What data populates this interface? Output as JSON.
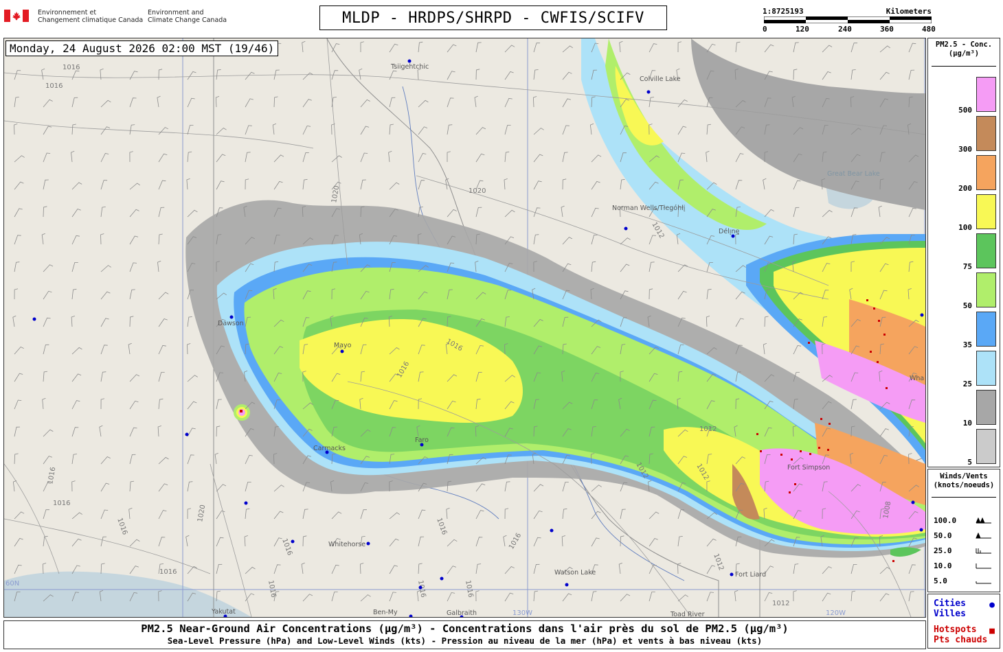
{
  "header": {
    "dept_fr_line1": "Environnement et",
    "dept_fr_line2": "Changement climatique Canada",
    "dept_en_line1": "Environment and",
    "dept_en_line2": "Climate Change Canada",
    "title": "MLDP - HRDPS/SHRPD - CWFIS/SCIFV"
  },
  "scale": {
    "ratio": "1:8725193",
    "units": "Kilometers",
    "ticks": [
      "0",
      "120",
      "240",
      "360",
      "480"
    ]
  },
  "timestamp": "Monday, 24 August 2026 02:00 MST (19/46)",
  "map": {
    "isobar_labels": [
      "1016",
      "1016",
      "1020",
      "1020",
      "1012",
      "1016",
      "1016",
      "1012",
      "1012",
      "1012",
      "1008",
      "1016",
      "1020",
      "1016",
      "1016",
      "1016",
      "1016",
      "1016",
      "1016",
      "1016",
      "1016",
      "1012",
      "1012",
      "1016"
    ],
    "places": [
      "Tsiigehtchic",
      "Colville Lake",
      "Norman Wells/Tłegóhłį",
      "Délı̨nę",
      "Great Bear Lake",
      "Dawson",
      "Mayo",
      "Carmacks",
      "Faro",
      "Whitehorse",
      "Watson Lake",
      "Fort Liard",
      "Yakutat",
      "Toad River",
      "Ben-My",
      "Galbraith",
      "Fort Simpson",
      "Wha"
    ],
    "grid_labels": [
      "60N",
      "130W",
      "120W"
    ],
    "colors": {
      "background": "#ece9e1",
      "water": "#c5d6de",
      "pink": "#f59cf5",
      "brown": "#c48a5a",
      "orange": "#f5a45e",
      "yellow": "#f8f855",
      "dark_green": "#5cc55c",
      "light_green": "#b0ee6b",
      "blue": "#5aa8f6",
      "light_blue": "#ade2f8",
      "dark_grey": "#a7a7a7",
      "light_grey": "#cbcbcb",
      "city": "#0000cc",
      "hotspot": "#cc0000"
    }
  },
  "legend_conc": {
    "title_line1": "PM2.5 - Conc.",
    "title_line2": "(µg/m³)",
    "items": [
      {
        "label": "500",
        "color": "#f59cf5"
      },
      {
        "label": "300",
        "color": "#c48a5a"
      },
      {
        "label": "200",
        "color": "#f5a45e"
      },
      {
        "label": "100",
        "color": "#f8f855"
      },
      {
        "label": "75",
        "color": "#5cc55c"
      },
      {
        "label": "50",
        "color": "#b0ee6b"
      },
      {
        "label": "35",
        "color": "#5aa8f6"
      },
      {
        "label": "25",
        "color": "#ade2f8"
      },
      {
        "label": "10",
        "color": "#a7a7a7"
      },
      {
        "label": "5",
        "color": "#cbcbcb"
      }
    ]
  },
  "legend_wind": {
    "title_line1": "Winds/Vents",
    "title_line2": "(knots/noeuds)",
    "items": [
      "100.0",
      "50.0",
      "25.0",
      "10.0",
      "5.0"
    ]
  },
  "legend_markers": {
    "cities_en": "Cities",
    "cities_fr": "Villes",
    "hotspots_en": "Hotspots",
    "hotspots_fr": "Pts chauds",
    "city_color": "#0000cc",
    "hotspot_color": "#cc0000"
  },
  "caption": {
    "line1": "PM2.5 Near-Ground Air Concentrations (µg/m³) - Concentrations dans l'air près du sol de PM2.5 (µg/m³)",
    "line2": "Sea-Level Pressure (hPa) and Low-Level Winds (kts) - Pression au niveau de la mer (hPa) et vents à bas niveau (kts)"
  }
}
